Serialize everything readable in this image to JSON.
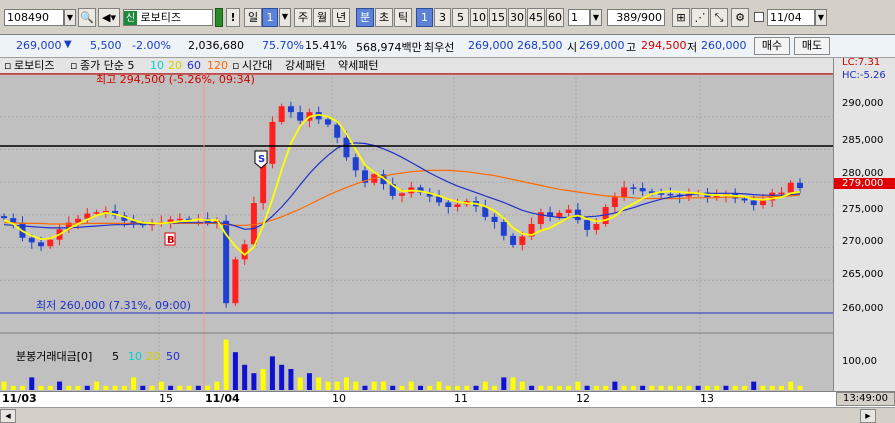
{
  "toolbar": {
    "code": "108490",
    "name_badge": "신",
    "name": "로보티즈",
    "excl": "!",
    "periods": [
      "일",
      "주",
      "월",
      "년",
      "분",
      "초",
      "틱"
    ],
    "period_num": "1",
    "minutes": [
      "1",
      "3",
      "5",
      "10",
      "15",
      "30",
      "45",
      "60"
    ],
    "min_custom": "1",
    "count": "389/900",
    "date": "11/04"
  },
  "quote": {
    "price": "269,000",
    "change": "5,500",
    "pct": "-2.00%",
    "volume": "2,036,680",
    "ratio": "75.70%",
    "turnover": "15.41%",
    "amount": "568,974백만",
    "ask_label": "최우선",
    "ask": "269,000",
    "bid": "268,500",
    "open_label": "시",
    "open": "269,000",
    "high_label": "고",
    "high": "294,500",
    "low_label": "저",
    "low": "260,000",
    "buy": "매수",
    "sell": "매도"
  },
  "legend": {
    "name": "로보티즈",
    "ma_label": "종가 단순 5",
    "ma2": "10",
    "ma3": "20",
    "ma4": "60",
    "ma5": "120",
    "ind1": "시간대",
    "ind2": "강세패턴",
    "ind3": "약세패턴",
    "lc": "LC:7.31",
    "hc": "HC:-5.26"
  },
  "annotations": {
    "high": "최고 294,500 (-5.26%, 09:34)",
    "low": "최저 260,000 (7.31%, 09:00)",
    "vol_title": "분봉거래대금[0]",
    "vol_ma": [
      "5",
      "10",
      "20",
      "50"
    ],
    "sell_mark": "S",
    "buy_mark": "B"
  },
  "yaxis": {
    "price_ticks": [
      "290,000",
      "285,000",
      "280,000",
      "275,000",
      "270,000",
      "265,000",
      "260,000"
    ],
    "current": "279,000",
    "vol_tick": "100,00"
  },
  "xaxis": {
    "labels": [
      "11/03",
      "15",
      "11/04",
      "10",
      "11",
      "12",
      "13"
    ],
    "time": "13:49:00"
  },
  "colors": {
    "up": "#ff2020",
    "down": "#2040d0",
    "ma5": "#ffff00",
    "ma20": "#2030c8",
    "ma60": "#ff6a00",
    "red_line": "#d00000",
    "blue_line": "#2030c8"
  },
  "chart_data": {
    "type": "candlestick",
    "y_range": [
      258000,
      296000
    ],
    "resistance": 281800,
    "day_high": 294500,
    "day_low": 260000,
    "current": 279000,
    "closes": [
      274500,
      273800,
      271500,
      270800,
      270200,
      271200,
      272800,
      273800,
      274400,
      275200,
      275400,
      275600,
      274900,
      274100,
      273700,
      273400,
      273700,
      273900,
      274300,
      274400,
      274200,
      274400,
      273900,
      274100,
      261500,
      268200,
      270500,
      276800,
      282800,
      289200,
      291600,
      290700,
      289400,
      290700,
      289600,
      288800,
      286800,
      283800,
      281800,
      279900,
      281200,
      279700,
      277900,
      278300,
      279200,
      278400,
      277800,
      276900,
      276200,
      276600,
      277100,
      276300,
      274700,
      273900,
      271800,
      270400,
      271700,
      273600,
      275400,
      274700,
      275300,
      275800,
      274200,
      272700,
      273600,
      276200,
      277700,
      279200,
      279100,
      278600,
      278300,
      278200,
      278100,
      277800,
      278200,
      278400,
      277700,
      277900,
      278200,
      277500,
      277200,
      276500,
      277200,
      278400,
      278400,
      279900,
      279100
    ],
    "ma5": [
      274200,
      273600,
      272500,
      271800,
      271300,
      271400,
      272000,
      272900,
      273600,
      274300,
      274900,
      275300,
      275100,
      274700,
      274200,
      273800,
      273700,
      273700,
      273800,
      274000,
      274100,
      274300,
      274200,
      274200,
      272000,
      270200,
      268900,
      270100,
      273400,
      277400,
      281900,
      285900,
      288600,
      290000,
      290300,
      290000,
      289300,
      287400,
      285000,
      282600,
      281500,
      280600,
      279500,
      278600,
      278700,
      278600,
      278300,
      277900,
      277400,
      277000,
      276800,
      276700,
      276300,
      275600,
      274500,
      273000,
      272100,
      271900,
      272600,
      273000,
      273800,
      274600,
      274900,
      274400,
      274000,
      274200,
      274800,
      276000,
      276700,
      277500,
      278200,
      278500,
      278600,
      278500,
      278400,
      278300,
      278100,
      278000,
      278000,
      277900,
      277800,
      277400,
      277300,
      277500,
      277700,
      278300,
      278500
    ],
    "ma20": [
      273500,
      273400,
      273300,
      273200,
      273100,
      273000,
      273000,
      273000,
      273100,
      273200,
      273300,
      273400,
      273500,
      273500,
      273600,
      273600,
      273600,
      273700,
      273700,
      273800,
      273800,
      273800,
      273800,
      273800,
      273700,
      273300,
      272800,
      272900,
      273600,
      274800,
      276200,
      277800,
      279600,
      281300,
      282800,
      284100,
      285200,
      285800,
      286000,
      285900,
      285600,
      285100,
      284500,
      283800,
      283000,
      282200,
      281400,
      280700,
      280000,
      279400,
      278900,
      278400,
      277900,
      277400,
      276900,
      276300,
      275700,
      275300,
      275000,
      274800,
      274600,
      274600,
      274600,
      274700,
      274800,
      275000,
      275300,
      275700,
      276100,
      276600,
      277000,
      277400,
      277700,
      277900,
      278100,
      278200,
      278300,
      278300,
      278300,
      278300,
      278200,
      278100,
      278000,
      278000,
      278000,
      278100,
      278200
    ],
    "ma60": [
      273800,
      273800,
      273700,
      273700,
      273700,
      273600,
      273600,
      273600,
      273600,
      273700,
      273700,
      273700,
      273700,
      273700,
      273700,
      273700,
      273700,
      273700,
      273700,
      273700,
      273700,
      273700,
      273700,
      273700,
      273500,
      273400,
      273400,
      273500,
      273800,
      274200,
      274700,
      275300,
      275900,
      276600,
      277300,
      278000,
      278600,
      279200,
      279700,
      280200,
      280600,
      280900,
      281200,
      281400,
      281600,
      281700,
      281800,
      281800,
      281800,
      281700,
      281600,
      281400,
      281200,
      281000,
      280700,
      280400,
      280100,
      279800,
      279500,
      279200,
      278900,
      278700,
      278500,
      278300,
      278100,
      277900,
      277800,
      277700,
      277600,
      277500,
      277500,
      277500,
      277500,
      277500,
      277600,
      277600,
      277600,
      277600,
      277700,
      277700,
      277700,
      277700,
      277700,
      277800,
      277800,
      277900,
      278000
    ],
    "volume": [
      2,
      1,
      1,
      3,
      1,
      1,
      2,
      1,
      1,
      1,
      2,
      1,
      1,
      1,
      3,
      1,
      1,
      2,
      1,
      1,
      1,
      1,
      1,
      2,
      12,
      9,
      6,
      4,
      5,
      8,
      6,
      5,
      3,
      4,
      3,
      2,
      2,
      3,
      2,
      1,
      2,
      2,
      1,
      1,
      2,
      1,
      1,
      2,
      1,
      1,
      1,
      1,
      2,
      1,
      3,
      3,
      2,
      1,
      1,
      1,
      1,
      1,
      2,
      1,
      1,
      1,
      2,
      1,
      1,
      1,
      1,
      1,
      1,
      1,
      1,
      1,
      1,
      1,
      1,
      1,
      1,
      2,
      1,
      1,
      1,
      2,
      1
    ]
  }
}
